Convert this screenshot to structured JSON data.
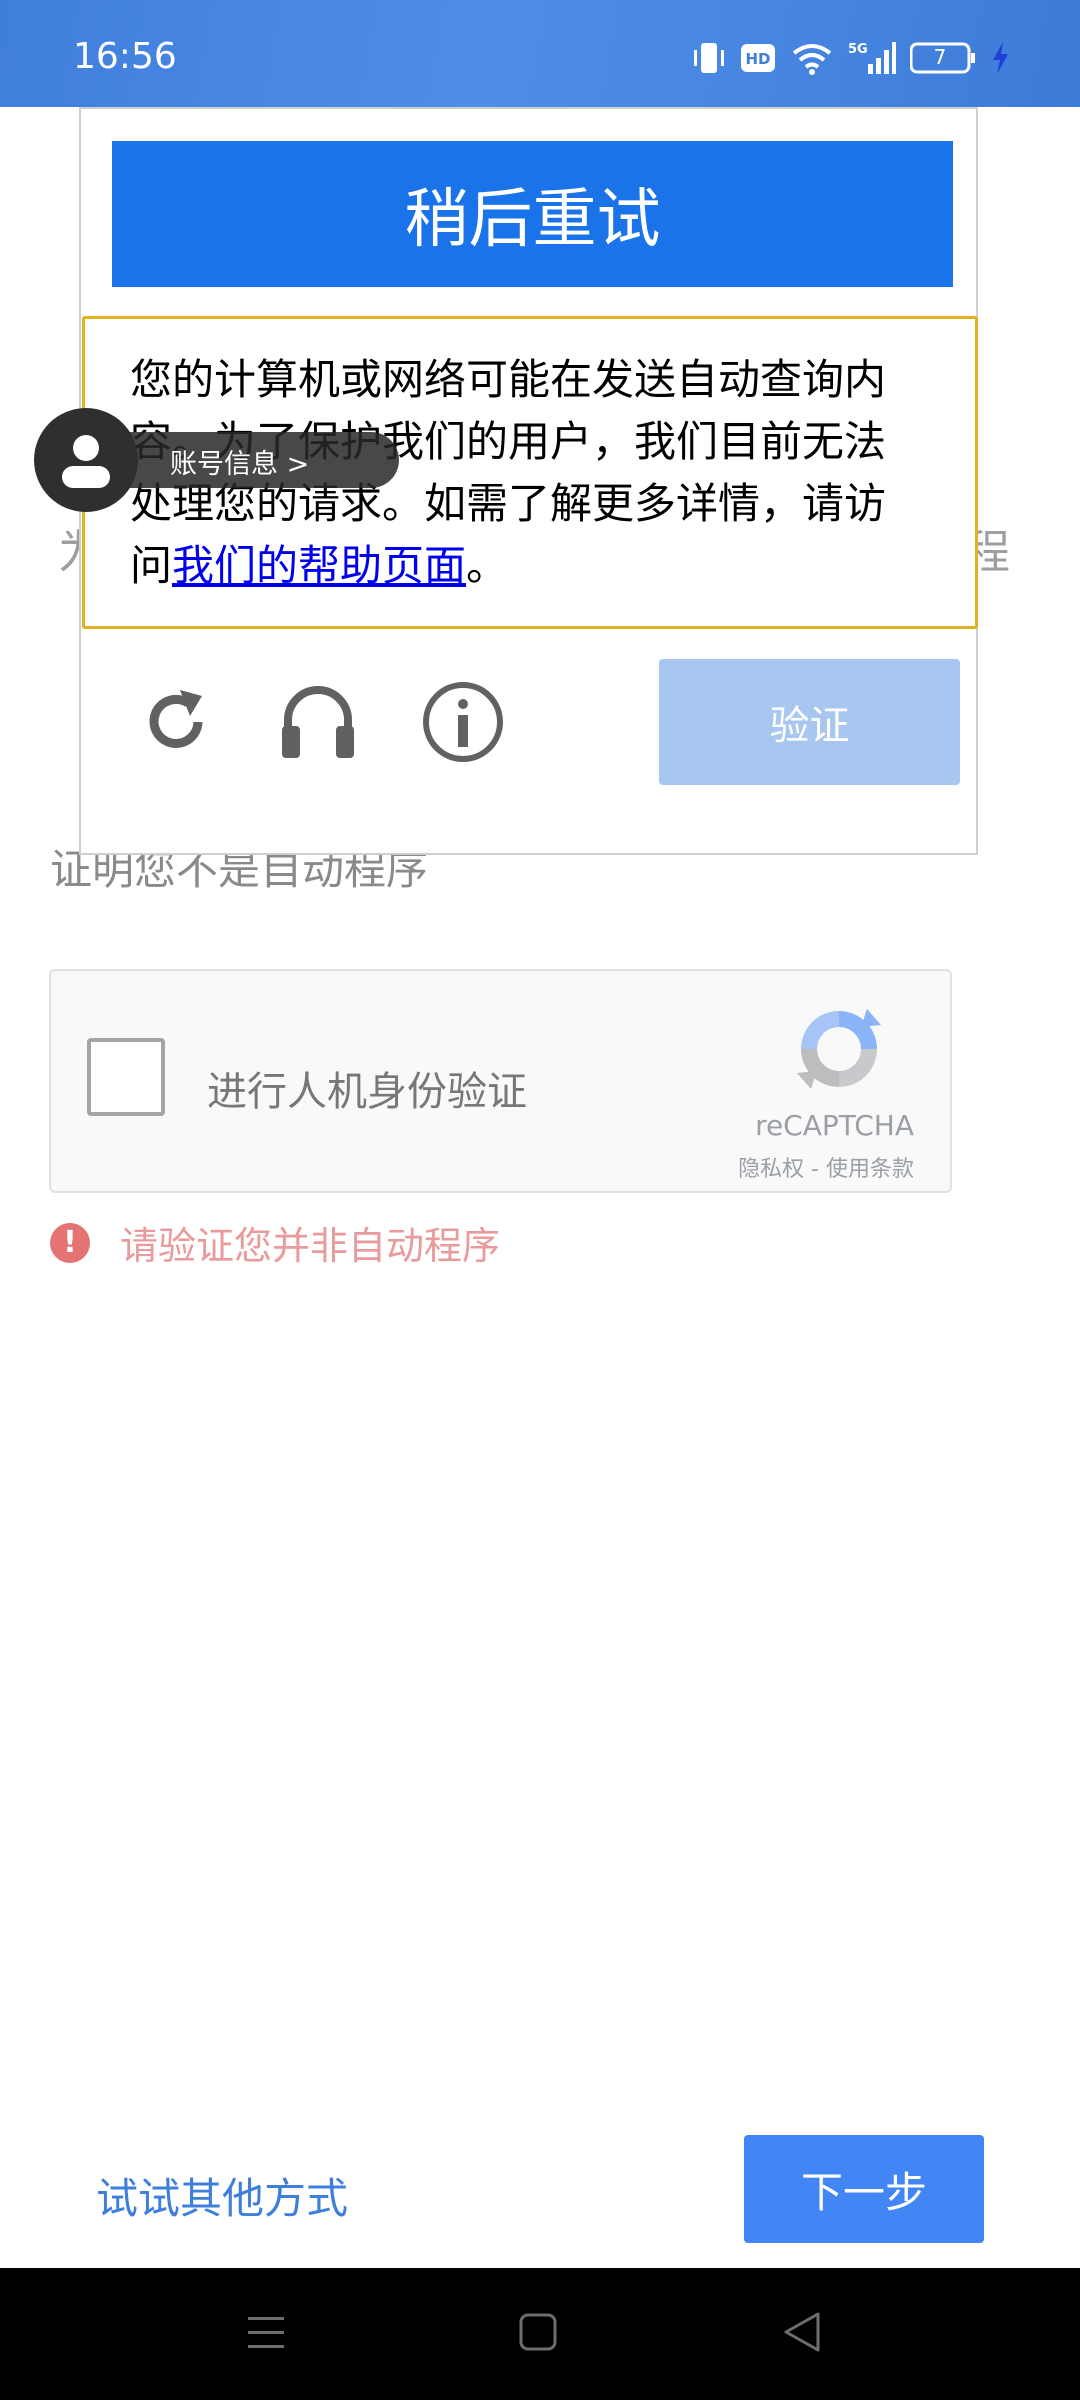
{
  "status_bar": {
    "time": "16:56",
    "network": "5G",
    "battery_level": "7",
    "icons": [
      "vibrate-icon",
      "hd-icon",
      "wifi-icon",
      "signal-5g-icon",
      "battery-icon",
      "charging-icon"
    ]
  },
  "background_page": {
    "partial_text_left": "为",
    "partial_text_right": "程",
    "verify_heading": "证明您不是自动程序",
    "recaptcha": {
      "checkbox_label": "进行人机身份验证",
      "brand": "reCAPTCHA",
      "terms": "隐私权 - 使用条款",
      "checked": false
    },
    "error_message": "请验证您并非自动程序"
  },
  "dialog": {
    "header": "稍后重试",
    "notice_text": "您的计算机或网络可能在发送自动查询内容。为了保护我们的用户，我们目前无法处理您的请求。如需了解更多详情，请访问",
    "notice_link": "我们的帮助页面",
    "notice_end": "。",
    "controls": [
      "reload-icon",
      "audio-icon",
      "info-icon"
    ],
    "verify_button": "验证"
  },
  "account_bubble": {
    "label": "账号信息 >"
  },
  "footer": {
    "try_other": "试试其他方式",
    "next": "下一步"
  },
  "colors": {
    "primary": "#1a73e8",
    "next_button": "#4285f4",
    "error": "#e57373",
    "notice_border": "#e1b123",
    "link": "#0000ee"
  }
}
